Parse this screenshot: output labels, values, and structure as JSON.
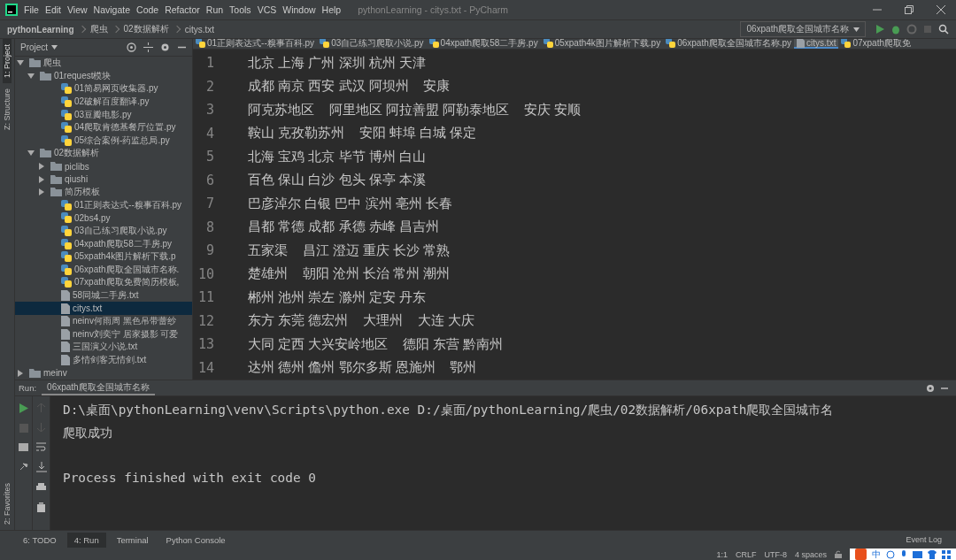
{
  "menu": [
    "File",
    "Edit",
    "View",
    "Navigate",
    "Code",
    "Refactor",
    "Run",
    "Tools",
    "VCS",
    "Window",
    "Help"
  ],
  "window": {
    "title": "pythonLearning - citys.txt - PyCharm"
  },
  "breadcrumbs": [
    "pythonLearning",
    "爬虫",
    "02数据解析",
    "citys.txt"
  ],
  "run_config": "06xpath爬取全国城市名称",
  "left_stripe": [
    {
      "label": "1: Project",
      "selected": true
    },
    {
      "label": "Z: Structure",
      "selected": false
    }
  ],
  "project_panel": {
    "title": "Project",
    "tree": [
      {
        "label": "爬虫",
        "kind": "folder",
        "expanded": true,
        "selected": false,
        "children": [
          {
            "label": "01request模块",
            "kind": "folder",
            "expanded": true,
            "selected": false,
            "children": [
              {
                "label": "01简易网页收集器.py",
                "kind": "py",
                "selected": false
              },
              {
                "label": "02破解百度翻译.py",
                "kind": "py",
                "selected": false
              },
              {
                "label": "03豆瓣电影.py",
                "kind": "py",
                "selected": false
              },
              {
                "label": "04爬取肯德基餐厅位置.py",
                "kind": "py",
                "selected": false
              },
              {
                "label": "05综合案例-药监总局.py",
                "kind": "py",
                "selected": false
              }
            ]
          },
          {
            "label": "02数据解析",
            "kind": "folder",
            "expanded": true,
            "selected": false,
            "children": [
              {
                "label": "piclibs",
                "kind": "folder",
                "expanded": false,
                "selected": false
              },
              {
                "label": "qiushi",
                "kind": "folder",
                "expanded": false,
                "selected": false
              },
              {
                "label": "简历模板",
                "kind": "folder",
                "expanded": false,
                "selected": false
              },
              {
                "label": "01正则表达式--糗事百科.py",
                "kind": "py",
                "selected": false
              },
              {
                "label": "02bs4.py",
                "kind": "py",
                "selected": false
              },
              {
                "label": "03自己练习爬取小说.py",
                "kind": "py",
                "selected": false
              },
              {
                "label": "04xpath爬取58二手房.py",
                "kind": "py",
                "selected": false
              },
              {
                "label": "05xpath4k图片解析下载.p",
                "kind": "py",
                "selected": false
              },
              {
                "label": "06xpath爬取全国城市名称.",
                "kind": "py",
                "selected": false
              },
              {
                "label": "07xpath爬取免费简历模板,",
                "kind": "py",
                "selected": false
              },
              {
                "label": "58同城二手房.txt",
                "kind": "txt",
                "selected": false
              },
              {
                "label": "citys.txt",
                "kind": "txt",
                "selected": true
              },
              {
                "label": "neinv何雨周 黑色吊带蕾纱",
                "kind": "txt",
                "selected": false
              },
              {
                "label": "neinv刘奕宁 居家摄影 可爱",
                "kind": "txt",
                "selected": false
              },
              {
                "label": "三国演义小说.txt",
                "kind": "txt",
                "selected": false
              },
              {
                "label": "多情剑客无情剑.txt",
                "kind": "txt",
                "selected": false
              }
            ]
          }
        ]
      },
      {
        "label": "meinv",
        "kind": "folder",
        "expanded": false,
        "selected": false
      }
    ]
  },
  "editor_tabs": [
    {
      "label": "01正则表达式--糗事百科.py",
      "kind": "py",
      "selected": false
    },
    {
      "label": "03自己练习爬取小说.py",
      "kind": "py",
      "selected": false
    },
    {
      "label": "04xpath爬取58二手房.py",
      "kind": "py",
      "selected": false
    },
    {
      "label": "05xpath4k图片解析下载.py",
      "kind": "py",
      "selected": false
    },
    {
      "label": "06xpath爬取全国城市名称.py",
      "kind": "py",
      "selected": false
    },
    {
      "label": "citys.txt",
      "kind": "txt",
      "selected": true
    },
    {
      "label": "07xpath爬取免",
      "kind": "py",
      "selected": false
    }
  ],
  "editor_lines": [
    {
      "number": "1",
      "text": "北京 上海 广州 深圳 杭州 天津"
    },
    {
      "number": "2",
      "text": "成都 南京 西安 武汉 阿坝州    安康"
    },
    {
      "number": "3",
      "text": "阿克苏地区    阿里地区 阿拉善盟 阿勒泰地区    安庆 安顺"
    },
    {
      "number": "4",
      "text": "鞍山 克孜勒苏州    安阳 蚌埠 白城 保定"
    },
    {
      "number": "5",
      "text": "北海 宝鸡 北京 毕节 博州 白山"
    },
    {
      "number": "6",
      "text": "百色 保山 白沙 包头 保亭 本溪"
    },
    {
      "number": "7",
      "text": "巴彦淖尔 白银 巴中 滨州 亳州 长春"
    },
    {
      "number": "8",
      "text": "昌都 常德 成都 承德 赤峰 昌吉州"
    },
    {
      "number": "9",
      "text": "五家渠    昌江 澄迈 重庆 长沙 常熟"
    },
    {
      "number": "10",
      "text": "楚雄州    朝阳 沧州 长治 常州 潮州"
    },
    {
      "number": "11",
      "text": "郴州 池州 崇左 滁州 定安 丹东"
    },
    {
      "number": "12",
      "text": "东方 东莞 德宏州    大理州    大连 大庆"
    },
    {
      "number": "13",
      "text": "大同 定西 大兴安岭地区    德阳 东营 黔南州"
    },
    {
      "number": "14",
      "text": "达州 德州 儋州 鄂尔多斯 恩施州    鄂州"
    }
  ],
  "run_panel": {
    "label": "Run:",
    "tab": "06xpath爬取全国城市名称",
    "output": [
      {
        "kind": "line",
        "text": "D:\\桌面\\pythonLearning\\venv\\Scripts\\python.exe D:/桌面/pythonLearning/爬虫/02数据解析/06xpath爬取全国城市名"
      },
      {
        "kind": "line",
        "text": "爬取成功"
      },
      {
        "kind": "after_blank",
        "text": "Process finished with exit code 0"
      }
    ]
  },
  "favorites": "2: Favorites",
  "bottom_tabs": [
    {
      "label": "6: TODO",
      "selected": false
    },
    {
      "label": "4: Run",
      "selected": true
    },
    {
      "label": "Terminal",
      "selected": false
    },
    {
      "label": "Python Console",
      "selected": false
    }
  ],
  "event_log": "Event Log",
  "status": [
    "1:1",
    "CRLF",
    "UTF-8",
    "4 spaces"
  ],
  "ime": "中"
}
